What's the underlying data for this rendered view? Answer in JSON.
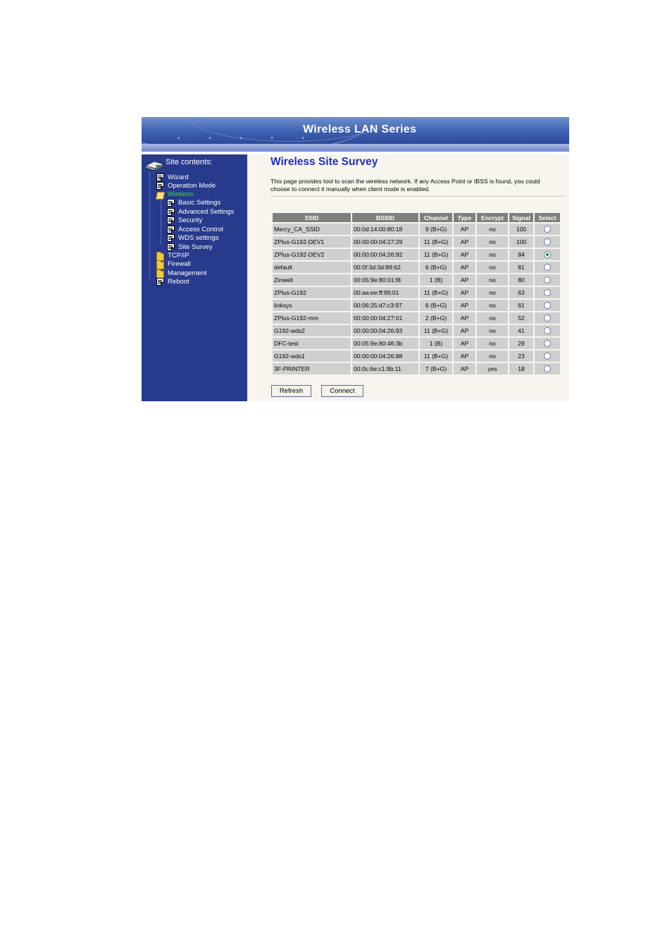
{
  "banner": {
    "title": "Wireless LAN Series"
  },
  "sidebar": {
    "header": "Site contents:",
    "items": [
      {
        "label": "Wizard"
      },
      {
        "label": "Operation Mode"
      },
      {
        "label": "Wireless"
      },
      {
        "label": "Basic Settings"
      },
      {
        "label": "Advanced Settings"
      },
      {
        "label": "Security"
      },
      {
        "label": "Access Control"
      },
      {
        "label": "WDS settings"
      },
      {
        "label": "Site Survey"
      },
      {
        "label": "TCP/IP"
      },
      {
        "label": "Firewall"
      },
      {
        "label": "Management"
      },
      {
        "label": "Reboot"
      }
    ]
  },
  "main": {
    "title": "Wireless Site Survey",
    "description": "This page provides tool to scan the wireless network. If any Access Point or IBSS is found, you could choose to connect it manually when client mode is enabled.",
    "table": {
      "headers": [
        "SSID",
        "BSSID",
        "Channel",
        "Type",
        "Encrypt",
        "Signal",
        "Select"
      ],
      "rows": [
        {
          "ssid": "Mercy_CA_SSID",
          "bssid": "00:0d:14:00:80:18",
          "channel": "9 (B+G)",
          "type": "AP",
          "encrypt": "no",
          "signal": "100",
          "selected": false
        },
        {
          "ssid": "ZPlus-G192-DEV1",
          "bssid": "00:00:00:04:27:29",
          "channel": "11 (B+G)",
          "type": "AP",
          "encrypt": "no",
          "signal": "100",
          "selected": false
        },
        {
          "ssid": "ZPlus-G192-DEV2",
          "bssid": "00:00:00:04:26:92",
          "channel": "11 (B+G)",
          "type": "AP",
          "encrypt": "no",
          "signal": "84",
          "selected": true
        },
        {
          "ssid": "default",
          "bssid": "00:0f:3d:3d:89:62",
          "channel": "6 (B+G)",
          "type": "AP",
          "encrypt": "no",
          "signal": "81",
          "selected": false
        },
        {
          "ssid": "Zinwell",
          "bssid": "00:05:9e:80:01:f8",
          "channel": "1 (B)",
          "type": "AP",
          "encrypt": "no",
          "signal": "80",
          "selected": false
        },
        {
          "ssid": "ZPlus-G192",
          "bssid": "00:aa:ee:ff:99:01",
          "channel": "11 (B+G)",
          "type": "AP",
          "encrypt": "no",
          "signal": "63",
          "selected": false
        },
        {
          "ssid": "linksys",
          "bssid": "00:06:25:d7:c3:97",
          "channel": "6 (B+G)",
          "type": "AP",
          "encrypt": "no",
          "signal": "61",
          "selected": false
        },
        {
          "ssid": "ZPlus-G192-mm",
          "bssid": "00:00:00:04:27:01",
          "channel": "2 (B+G)",
          "type": "AP",
          "encrypt": "no",
          "signal": "52",
          "selected": false
        },
        {
          "ssid": "G192-wds2",
          "bssid": "00:00:00:04:26:93",
          "channel": "11 (B+G)",
          "type": "AP",
          "encrypt": "no",
          "signal": "41",
          "selected": false
        },
        {
          "ssid": "DFC-test",
          "bssid": "00:05:9e:80:46:3b",
          "channel": "1 (B)",
          "type": "AP",
          "encrypt": "no",
          "signal": "29",
          "selected": false
        },
        {
          "ssid": "G192-wds1",
          "bssid": "00:00:00:04:26:88",
          "channel": "11 (B+G)",
          "type": "AP",
          "encrypt": "no",
          "signal": "23",
          "selected": false
        },
        {
          "ssid": "3F-PRINTER",
          "bssid": "00:0c:6e:c1:9b:11",
          "channel": "7 (B+G)",
          "type": "AP",
          "encrypt": "yes",
          "signal": "18",
          "selected": false
        }
      ]
    },
    "buttons": {
      "refresh": "Refresh",
      "connect": "Connect"
    }
  }
}
